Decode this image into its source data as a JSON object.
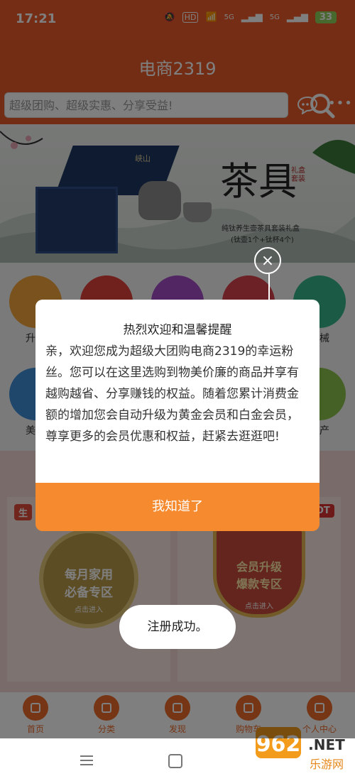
{
  "status_bar": {
    "time": "17:21",
    "hd": "HD",
    "net1": "5G",
    "net2": "5G",
    "battery": "33"
  },
  "header": {
    "title": "电商2319",
    "more": "•••"
  },
  "search": {
    "placeholder": "超级团购、超级实惠、分享受益!"
  },
  "banner": {
    "big_text": "茶具",
    "seal": "礼盒套装",
    "line1": "纯钛养生壶茶具套装礼盒",
    "line2": "(钛壶1个+钛杯4个)",
    "box_label": "峡山"
  },
  "categories_row1": [
    {
      "label": "升级",
      "color": "#f3a43a"
    },
    {
      "label": "",
      "color": "#e0413a"
    },
    {
      "label": "",
      "color": "#a24cc6"
    },
    {
      "label": "",
      "color": "#d9424d"
    },
    {
      "label": "器械",
      "color": "#36b58a"
    }
  ],
  "categories_row2": [
    {
      "label": "美妆",
      "color": "#3f8fd8"
    },
    {
      "label": "",
      "color": "#f0a33b"
    },
    {
      "label": "",
      "color": "#e85a6b"
    },
    {
      "label": "",
      "color": "#4aa86a"
    },
    {
      "label": "特产",
      "color": "#8bc34a"
    }
  ],
  "promo": {
    "left_tag": "生",
    "left_title": "每月家用\n必备专区",
    "left_action": "点击进入",
    "right_tag": "HOT",
    "right_title": "会员升级\n爆款专区",
    "right_action": "点击进入"
  },
  "dialog": {
    "title": "热烈欢迎和温馨提醒",
    "body": "亲，欢迎您成为超级大团购电商2319的幸运粉丝。您可以在这里选购到物美价廉的商品并享有越购越省、分享赚钱的权益。随着您累计消费金额的增加您会自动升级为黄金会员和白金会员，尊享更多的会员优惠和权益，赶紧去逛逛吧!",
    "ok_label": "我知道了",
    "close": "×"
  },
  "toast": "注册成功。",
  "bottom_nav": [
    {
      "label": "首页",
      "icon": "home-icon"
    },
    {
      "label": "分类",
      "icon": "grid-icon"
    },
    {
      "label": "发现",
      "icon": "search-icon"
    },
    {
      "label": "购物车",
      "icon": "cart-icon"
    },
    {
      "label": "个人中心",
      "icon": "user-icon"
    }
  ],
  "watermark": {
    "brand": "962.NET",
    "sub": "乐游网"
  }
}
